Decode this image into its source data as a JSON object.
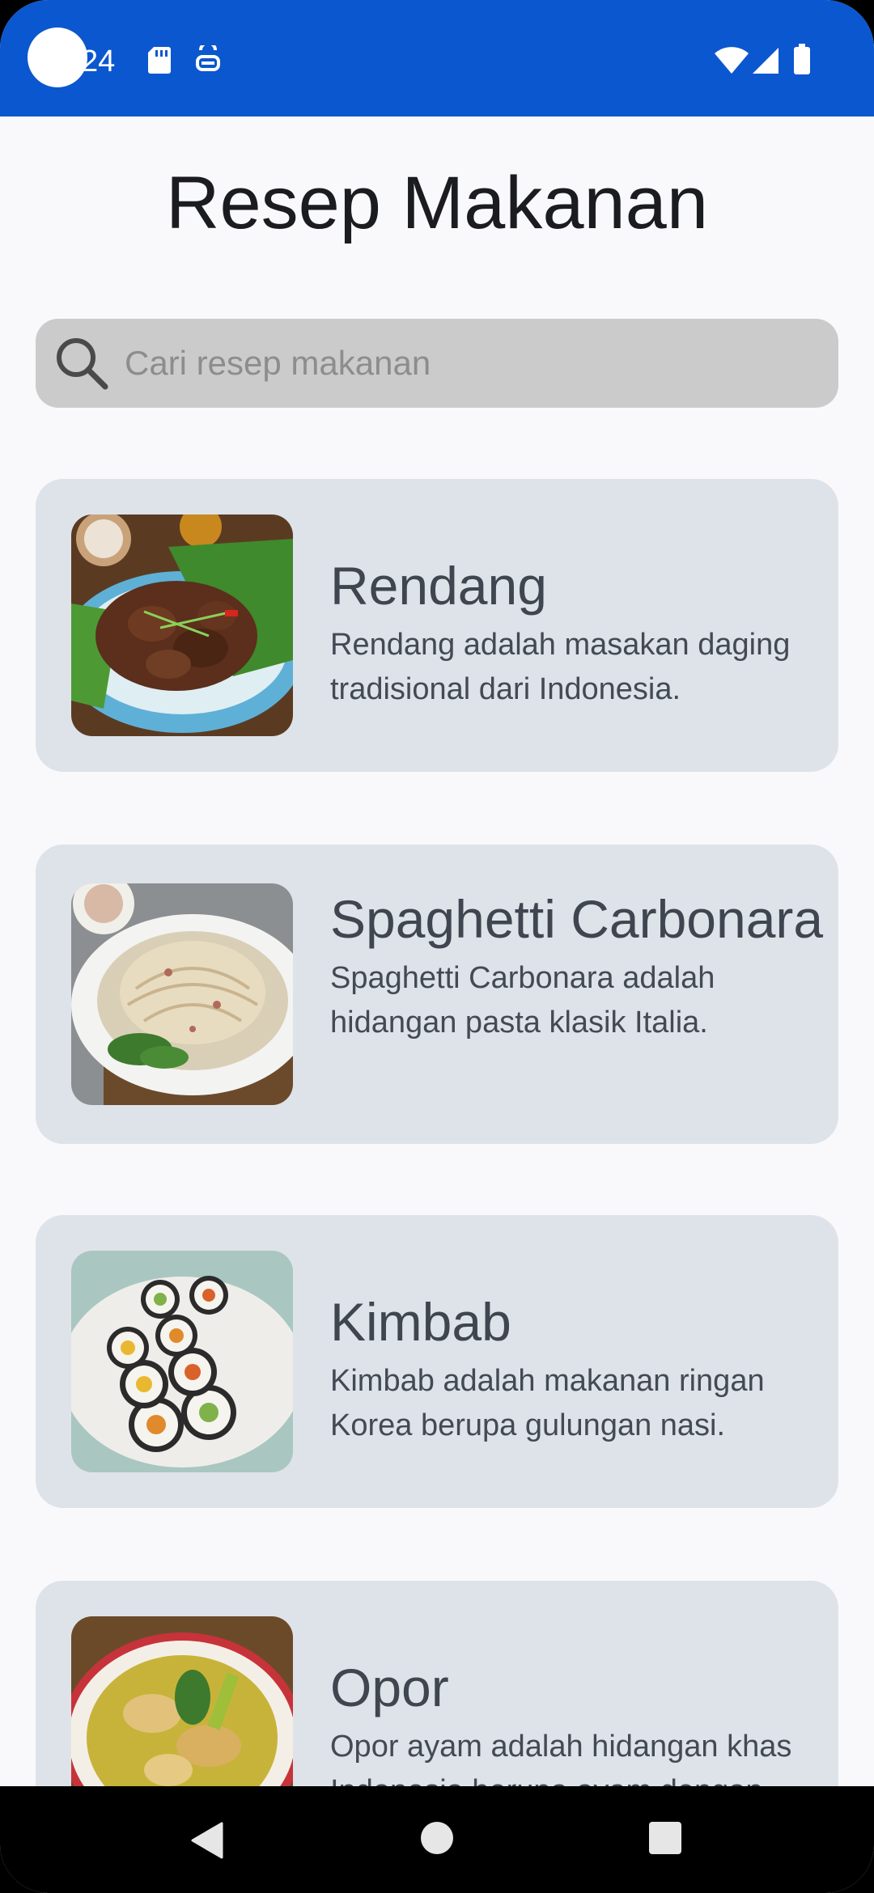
{
  "status_bar": {
    "time": "24",
    "background": "#0b57cf",
    "icons": [
      "sd-card-icon",
      "app-notification-icon",
      "wifi-icon",
      "cellular-signal-icon",
      "battery-icon"
    ]
  },
  "header": {
    "title": "Resep Makanan"
  },
  "search": {
    "placeholder": "Cari resep makanan",
    "value": "",
    "icon": "search-icon"
  },
  "recipes": [
    {
      "title": "Rendang",
      "description": "Rendang adalah masakan daging tradisional dari Indonesia.",
      "image": "rendang-photo"
    },
    {
      "title": "Spaghetti Carbonara",
      "description": "Spaghetti Carbonara adalah hidangan pasta klasik Italia.",
      "image": "spaghetti-carbonara-photo"
    },
    {
      "title": "Kimbab",
      "description": "Kimbab adalah makanan ringan Korea berupa gulungan nasi.",
      "image": "kimbab-photo"
    },
    {
      "title": "Opor",
      "description": "Opor ayam adalah hidangan khas Indonesia berupa ayam dengan",
      "image": "opor-photo"
    }
  ],
  "nav_bar": {
    "icons": [
      "back-icon",
      "home-icon",
      "recents-icon"
    ]
  },
  "colors": {
    "accent": "#0b57cf",
    "background": "#f9f9fb",
    "card": "#dee3e9",
    "search_field": "#cbcbcb"
  }
}
